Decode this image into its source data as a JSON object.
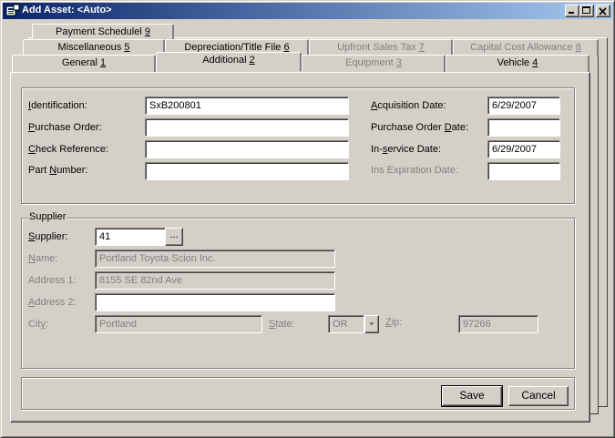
{
  "window": {
    "title": "Add Asset: <Auto>",
    "controls": {
      "minimize": "_",
      "maximize": "□",
      "close": "×"
    }
  },
  "tabs": {
    "row1": [
      {
        "label": "Payment Schedulel ",
        "key": "9",
        "disabled": false
      }
    ],
    "row2": [
      {
        "label": "Miscellaneous ",
        "key": "5",
        "disabled": false
      },
      {
        "label": "Depreciation/Title File ",
        "key": "6",
        "disabled": false
      },
      {
        "label": "Upfront Sales Tax ",
        "key": "7",
        "disabled": true
      },
      {
        "label": "Capital Cost Allowance ",
        "key": "8",
        "disabled": true
      }
    ],
    "row3": [
      {
        "label": "General ",
        "key": "1",
        "disabled": false
      },
      {
        "label": "Additional ",
        "key": "2",
        "disabled": false,
        "active": true
      },
      {
        "label": "Equipment ",
        "key": "3",
        "disabled": true
      },
      {
        "label": "Vehicle ",
        "key": "4",
        "disabled": false
      }
    ]
  },
  "identity": {
    "identification": {
      "label_pre": "",
      "label_key": "I",
      "label_post": "dentification:",
      "value": "SxB200801"
    },
    "purchase_order": {
      "label_pre": "",
      "label_key": "P",
      "label_post": "urchase Order:",
      "value": ""
    },
    "check_reference": {
      "label_pre": "",
      "label_key": "C",
      "label_post": "heck Reference:",
      "value": ""
    },
    "part_number": {
      "label_pre": "Part ",
      "label_key": "N",
      "label_post": "umber:",
      "value": ""
    },
    "acquisition_date": {
      "label_pre": "",
      "label_key": "A",
      "label_post": "cquisition Date:",
      "value": "6/29/2007"
    },
    "purchase_order_date": {
      "label_pre": "Purchase Order ",
      "label_key": "D",
      "label_post": "ate:",
      "value": ""
    },
    "in_service_date": {
      "label_pre": "In-",
      "label_key": "s",
      "label_post": "ervice Date:",
      "value": "6/29/2007"
    },
    "ins_expiration_date": {
      "label": "Ins Expiration Date:",
      "value": ""
    }
  },
  "supplier": {
    "group_label": "Supplier",
    "supplier": {
      "label_pre": "",
      "label_key": "S",
      "label_post": "upplier:",
      "value": "41",
      "lookup_label": "..."
    },
    "name": {
      "label_pre": "",
      "label_key": "N",
      "label_post": "ame:",
      "value": "Portland Toyota Scion Inc."
    },
    "address1": {
      "label": "Address 1:",
      "value": "8155 SE 82nd Ave"
    },
    "address2": {
      "label_pre": "",
      "label_key": "A",
      "label_post": "ddress 2:",
      "value": ""
    },
    "city": {
      "label_pre": "Cit",
      "label_key": "y",
      "label_post": ":",
      "value": "Portland"
    },
    "state": {
      "label_pre": "",
      "label_key": "S",
      "label_post": "tate:",
      "value": "OR"
    },
    "zip": {
      "label_pre": "",
      "label_key": "Z",
      "label_post": "ip:",
      "value": "97266"
    }
  },
  "buttons": {
    "save": "Save",
    "cancel": "Cancel"
  }
}
